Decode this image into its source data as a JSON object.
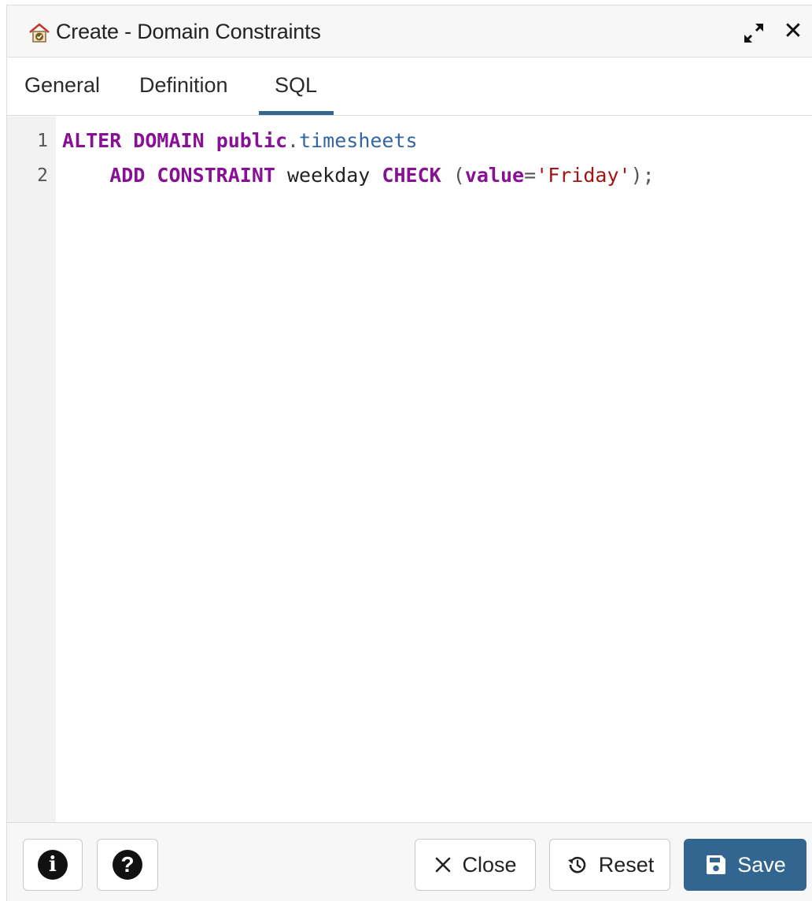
{
  "dialog": {
    "title": "Create - Domain Constraints",
    "title_icon": "domain-constraint-icon",
    "maximize_icon": "expand-arrows-icon",
    "close_icon": "close-icon"
  },
  "tabs": [
    {
      "label": "General",
      "active": false
    },
    {
      "label": "Definition",
      "active": false
    },
    {
      "label": "SQL",
      "active": true
    }
  ],
  "editor": {
    "line_numbers": [
      "1",
      "2"
    ],
    "lines": [
      {
        "kw1": "ALTER DOMAIN",
        "kw2": "public",
        "dot": ".",
        "ident": "timesheets"
      },
      {
        "indent": "    ",
        "kw1": "ADD CONSTRAINT",
        "name": "weekday",
        "kw2": "CHECK",
        "paren_open": "(",
        "kw3": "value",
        "eq": "=",
        "str": "'Friday'",
        "tail": ");"
      }
    ]
  },
  "footer": {
    "info_icon": "info-icon",
    "help_icon": "help-icon",
    "close_label": "Close",
    "reset_label": "Reset",
    "save_label": "Save"
  },
  "colors": {
    "accent": "#326690",
    "keyword": "#871094",
    "identifier": "#3465a4",
    "string": "#a31515"
  }
}
